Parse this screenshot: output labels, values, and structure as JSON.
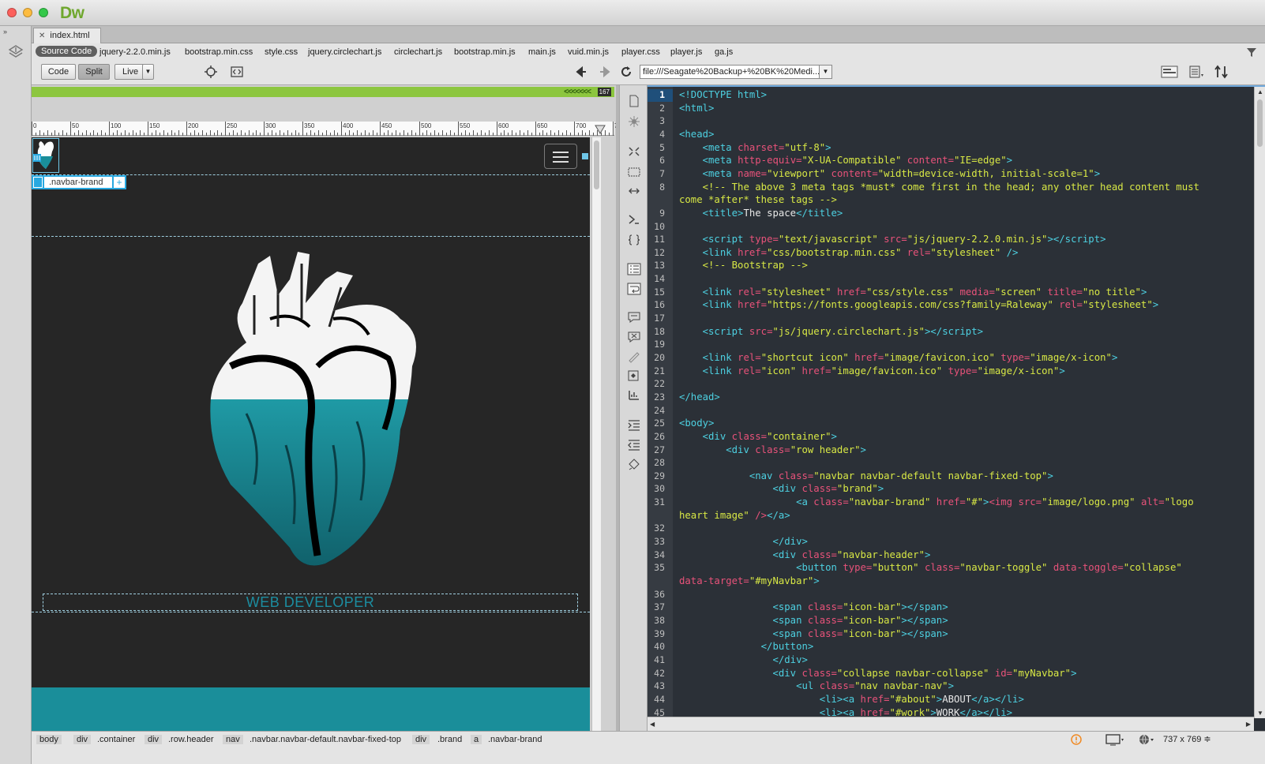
{
  "app": {
    "logo": "Dw"
  },
  "document_tab": {
    "name": "index.html",
    "close": "✕"
  },
  "related_files": [
    "Source Code",
    "jquery-2.2.0.min.js",
    "bootstrap.min.css",
    "style.css",
    "jquery.circlechart.js",
    "circlechart.js",
    "bootstrap.min.js",
    "main.js",
    "vuid.min.js",
    "player.css",
    "player.js",
    "ga.js"
  ],
  "toolbar": {
    "code_label": "Code",
    "split_label": "Split",
    "live_label": "Live",
    "address": "file:///Seagate%20Backup+%20BK%20Medi..."
  },
  "design_view": {
    "element_count": "167",
    "ruler_labels": [
      "0",
      "50",
      "100",
      "150",
      "200",
      "250",
      "300",
      "350",
      "400",
      "450",
      "500",
      "550",
      "600",
      "650",
      "700",
      "7"
    ],
    "selected_tag": ".navbar-brand",
    "add_label": "+",
    "hero_text": "WEB DEVELOPER"
  },
  "code_lines": [
    {
      "n": "1",
      "html": "<span class=\"c-tag\">&lt;!DOCTYPE html&gt;</span>"
    },
    {
      "n": "2",
      "html": "<span class=\"c-tag\">&lt;html&gt;</span>"
    },
    {
      "n": "3",
      "html": ""
    },
    {
      "n": "4",
      "html": "<span class=\"c-tag\">&lt;head&gt;</span>"
    },
    {
      "n": "5",
      "html": "    <span class=\"c-tag\">&lt;meta</span> <span class=\"c-attr\">charset=</span><span class=\"c-val\">\"utf-8\"</span><span class=\"c-tag\">&gt;</span>"
    },
    {
      "n": "6",
      "html": "    <span class=\"c-tag\">&lt;meta</span> <span class=\"c-attr\">http-equiv=</span><span class=\"c-val\">\"X-UA-Compatible\"</span> <span class=\"c-attr\">content=</span><span class=\"c-val\">\"IE=edge\"</span><span class=\"c-tag\">&gt;</span>"
    },
    {
      "n": "7",
      "html": "    <span class=\"c-tag\">&lt;meta</span> <span class=\"c-attr\">name=</span><span class=\"c-val\">\"viewport\"</span> <span class=\"c-attr\">content=</span><span class=\"c-val\">\"width=device-width, initial-scale=1\"</span><span class=\"c-tag\">&gt;</span>"
    },
    {
      "n": "8",
      "html": "    <span class=\"c-com\">&lt;!-- The above 3 meta tags *must* come first in the head; any other head content must</span>"
    },
    {
      "n": "",
      "html": "<span class=\"c-com\">come *after* these tags --&gt;</span>"
    },
    {
      "n": "9",
      "html": "    <span class=\"c-tag\">&lt;title&gt;</span>The space<span class=\"c-tag\">&lt;/title&gt;</span>"
    },
    {
      "n": "10",
      "html": ""
    },
    {
      "n": "11",
      "html": "    <span class=\"c-tag\">&lt;script</span> <span class=\"c-attr\">type=</span><span class=\"c-val\">\"text/javascript\"</span> <span class=\"c-attr\">src=</span><span class=\"c-val\">\"js/jquery-2.2.0.min.js\"</span><span class=\"c-tag\">&gt;&lt;/script&gt;</span>"
    },
    {
      "n": "12",
      "html": "    <span class=\"c-tag\">&lt;link</span> <span class=\"c-attr\">href=</span><span class=\"c-val\">\"css/bootstrap.min.css\"</span> <span class=\"c-attr\">rel=</span><span class=\"c-val\">\"stylesheet\"</span> <span class=\"c-tag\">/&gt;</span>"
    },
    {
      "n": "13",
      "html": "    <span class=\"c-com\">&lt;!-- Bootstrap --&gt;</span>"
    },
    {
      "n": "14",
      "html": ""
    },
    {
      "n": "15",
      "html": "    <span class=\"c-tag\">&lt;link</span> <span class=\"c-attr\">rel=</span><span class=\"c-val\">\"stylesheet\"</span> <span class=\"c-attr\">href=</span><span class=\"c-val\">\"css/style.css\"</span> <span class=\"c-attr\">media=</span><span class=\"c-val\">\"screen\"</span> <span class=\"c-attr\">title=</span><span class=\"c-val\">\"no title\"</span><span class=\"c-tag\">&gt;</span>"
    },
    {
      "n": "16",
      "html": "    <span class=\"c-tag\">&lt;link</span> <span class=\"c-attr\">href=</span><span class=\"c-val\">\"https://fonts.googleapis.com/css?family=Raleway\"</span> <span class=\"c-attr\">rel=</span><span class=\"c-val\">\"stylesheet\"</span><span class=\"c-tag\">&gt;</span>"
    },
    {
      "n": "17",
      "html": ""
    },
    {
      "n": "18",
      "html": "    <span class=\"c-tag\">&lt;script</span> <span class=\"c-attr\">src=</span><span class=\"c-val\">\"js/jquery.circlechart.js\"</span><span class=\"c-tag\">&gt;&lt;/script&gt;</span>"
    },
    {
      "n": "19",
      "html": ""
    },
    {
      "n": "20",
      "html": "    <span class=\"c-tag\">&lt;link</span> <span class=\"c-attr\">rel=</span><span class=\"c-val\">\"shortcut icon\"</span> <span class=\"c-attr\">href=</span><span class=\"c-val\">\"image/favicon.ico\"</span> <span class=\"c-attr\">type=</span><span class=\"c-val\">\"image/x-icon\"</span><span class=\"c-tag\">&gt;</span>"
    },
    {
      "n": "21",
      "html": "    <span class=\"c-tag\">&lt;link</span> <span class=\"c-attr\">rel=</span><span class=\"c-val\">\"icon\"</span> <span class=\"c-attr\">href=</span><span class=\"c-val\">\"image/favicon.ico\"</span> <span class=\"c-attr\">type=</span><span class=\"c-val\">\"image/x-icon\"</span><span class=\"c-tag\">&gt;</span>"
    },
    {
      "n": "22",
      "html": ""
    },
    {
      "n": "23",
      "html": "<span class=\"c-tag\">&lt;/head&gt;</span>"
    },
    {
      "n": "24",
      "html": ""
    },
    {
      "n": "25",
      "html": "<span class=\"c-tag\">&lt;body&gt;</span>"
    },
    {
      "n": "26",
      "html": "    <span class=\"c-tag\">&lt;div</span> <span class=\"c-attr\">class=</span><span class=\"c-val\">\"container\"</span><span class=\"c-tag\">&gt;</span>"
    },
    {
      "n": "27",
      "html": "        <span class=\"c-tag\">&lt;div</span> <span class=\"c-attr\">class=</span><span class=\"c-val\">\"row header\"</span><span class=\"c-tag\">&gt;</span>"
    },
    {
      "n": "28",
      "html": ""
    },
    {
      "n": "29",
      "html": "            <span class=\"c-tag\">&lt;nav</span> <span class=\"c-attr\">class=</span><span class=\"c-val\">\"navbar navbar-default navbar-fixed-top\"</span><span class=\"c-tag\">&gt;</span>"
    },
    {
      "n": "30",
      "html": "                <span class=\"c-tag\">&lt;div</span> <span class=\"c-attr\">class=</span><span class=\"c-val\">\"brand\"</span><span class=\"c-tag\">&gt;</span>"
    },
    {
      "n": "31",
      "html": "                    <span class=\"c-tag\">&lt;a</span> <span class=\"c-attr\">class=</span><span class=\"c-val\">\"navbar-brand\"</span> <span class=\"c-attr\">href=</span><span class=\"c-val\">\"#\"</span><span class=\"c-tag\">&gt;</span><span class=\"c-attr\">&lt;img</span> <span class=\"c-attr\">src=</span><span class=\"c-val\">\"image/logo.png\"</span> <span class=\"c-attr\">alt=</span><span class=\"c-val\">\"logo</span>"
    },
    {
      "n": "",
      "html": "<span class=\"c-val\">heart image\"</span> <span class=\"c-attr\">/&gt;</span><span class=\"c-tag\">&lt;/a&gt;</span>"
    },
    {
      "n": "32",
      "html": ""
    },
    {
      "n": "33",
      "html": "                <span class=\"c-tag\">&lt;/div&gt;</span>"
    },
    {
      "n": "34",
      "html": "                <span class=\"c-tag\">&lt;div</span> <span class=\"c-attr\">class=</span><span class=\"c-val\">\"navbar-header\"</span><span class=\"c-tag\">&gt;</span>"
    },
    {
      "n": "35",
      "html": "                    <span class=\"c-tag\">&lt;button</span> <span class=\"c-attr\">type=</span><span class=\"c-val\">\"button\"</span> <span class=\"c-attr\">class=</span><span class=\"c-val\">\"navbar-toggle\"</span> <span class=\"c-attr\">data-toggle=</span><span class=\"c-val\">\"collapse\"</span>"
    },
    {
      "n": "",
      "html": "<span class=\"c-attr\">data-target=</span><span class=\"c-val\">\"#myNavbar\"</span><span class=\"c-tag\">&gt;</span>"
    },
    {
      "n": "36",
      "html": ""
    },
    {
      "n": "37",
      "html": "                <span class=\"c-tag\">&lt;span</span> <span class=\"c-attr\">class=</span><span class=\"c-val\">\"icon-bar\"</span><span class=\"c-tag\">&gt;&lt;/span&gt;</span>"
    },
    {
      "n": "38",
      "html": "                <span class=\"c-tag\">&lt;span</span> <span class=\"c-attr\">class=</span><span class=\"c-val\">\"icon-bar\"</span><span class=\"c-tag\">&gt;&lt;/span&gt;</span>"
    },
    {
      "n": "39",
      "html": "                <span class=\"c-tag\">&lt;span</span> <span class=\"c-attr\">class=</span><span class=\"c-val\">\"icon-bar\"</span><span class=\"c-tag\">&gt;&lt;/span&gt;</span>"
    },
    {
      "n": "40",
      "html": "              <span class=\"c-tag\">&lt;/button&gt;</span>"
    },
    {
      "n": "41",
      "html": "                <span class=\"c-tag\">&lt;/div&gt;</span>"
    },
    {
      "n": "42",
      "html": "                <span class=\"c-tag\">&lt;div</span> <span class=\"c-attr\">class=</span><span class=\"c-val\">\"collapse navbar-collapse\"</span> <span class=\"c-attr\">id=</span><span class=\"c-val\">\"myNavbar\"</span><span class=\"c-tag\">&gt;</span>"
    },
    {
      "n": "43",
      "html": "                    <span class=\"c-tag\">&lt;ul</span> <span class=\"c-attr\">class=</span><span class=\"c-val\">\"nav navbar-nav\"</span><span class=\"c-tag\">&gt;</span>"
    },
    {
      "n": "44",
      "html": "                        <span class=\"c-tag\">&lt;li&gt;&lt;a</span> <span class=\"c-attr\">href=</span><span class=\"c-val\">\"#about\"</span><span class=\"c-tag\">&gt;</span>ABOUT<span class=\"c-tag\">&lt;/a&gt;&lt;/li&gt;</span>"
    },
    {
      "n": "45",
      "html": "                        <span class=\"c-tag\">&lt;li&gt;&lt;a</span> <span class=\"c-attr\">href=</span><span class=\"c-val\">\"#work\"</span><span class=\"c-tag\">&gt;</span>WORK<span class=\"c-tag\">&lt;/a&gt;&lt;/li&gt;</span>"
    }
  ],
  "tag_selector": [
    "body",
    "div",
    ".container",
    "div",
    ".row.header",
    "nav",
    ".navbar.navbar-default.navbar-fixed-top",
    "div",
    ".brand",
    "a",
    ".navbar-brand"
  ],
  "status": {
    "window_size": "737 x 769 ≑"
  }
}
